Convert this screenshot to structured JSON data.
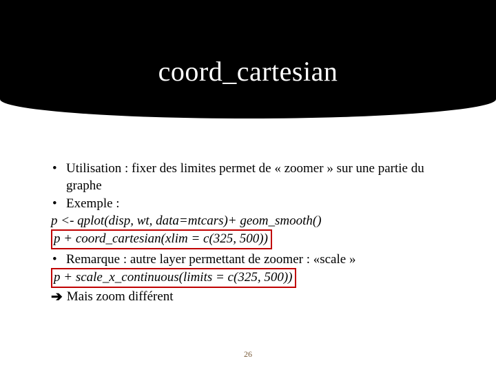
{
  "title": "coord_cartesian",
  "bullets": {
    "b1": "Utilisation : fixer des limites permet de « zoomer » sur une partie du graphe",
    "b2": "Exemple :",
    "code1": "p <- qplot(disp, wt, data=mtcars)+ geom_smooth()",
    "code2": "p + coord_cartesian(xlim = c(325, 500))",
    "b3": "Remarque : autre layer permettant de zoomer : «scale »",
    "code3": "p + scale_x_continuous(limits = c(325, 500))",
    "arrow_text": "Mais zoom différent"
  },
  "page_number": "26",
  "arrow_glyph": "➔"
}
